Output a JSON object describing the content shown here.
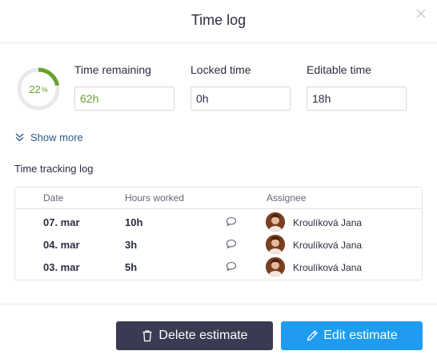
{
  "dialog": {
    "title": "Time log"
  },
  "progress": {
    "value": "22",
    "unit": "%",
    "fraction": 0.22,
    "color": "#6aa12c"
  },
  "fields": {
    "remaining": {
      "label": "Time remaining",
      "value": "62h"
    },
    "locked": {
      "label": "Locked time",
      "value": "0h"
    },
    "editable": {
      "label": "Editable time",
      "value": "18h"
    }
  },
  "show_more": {
    "label": "Show more",
    "icon": "double-chevron-down-icon"
  },
  "log": {
    "title": "Time tracking log",
    "columns": {
      "date": "Date",
      "hours": "Hours worked",
      "assignee": "Assignee"
    },
    "rows": [
      {
        "date": "07. mar",
        "hours": "10h",
        "assignee": "Kroulíková Jana"
      },
      {
        "date": "04. mar",
        "hours": "3h",
        "assignee": "Kroulíková Jana"
      },
      {
        "date": "03. mar",
        "hours": "5h",
        "assignee": "Kroulíková Jana"
      }
    ]
  },
  "actions": {
    "delete": {
      "label": "Delete estimate",
      "icon": "trash-icon",
      "color": "#3a3b52"
    },
    "edit": {
      "label": "Edit estimate",
      "icon": "pencil-icon",
      "color": "#1f9cf0"
    }
  },
  "icons": {
    "close": "close-icon",
    "comment": "comment-icon"
  }
}
